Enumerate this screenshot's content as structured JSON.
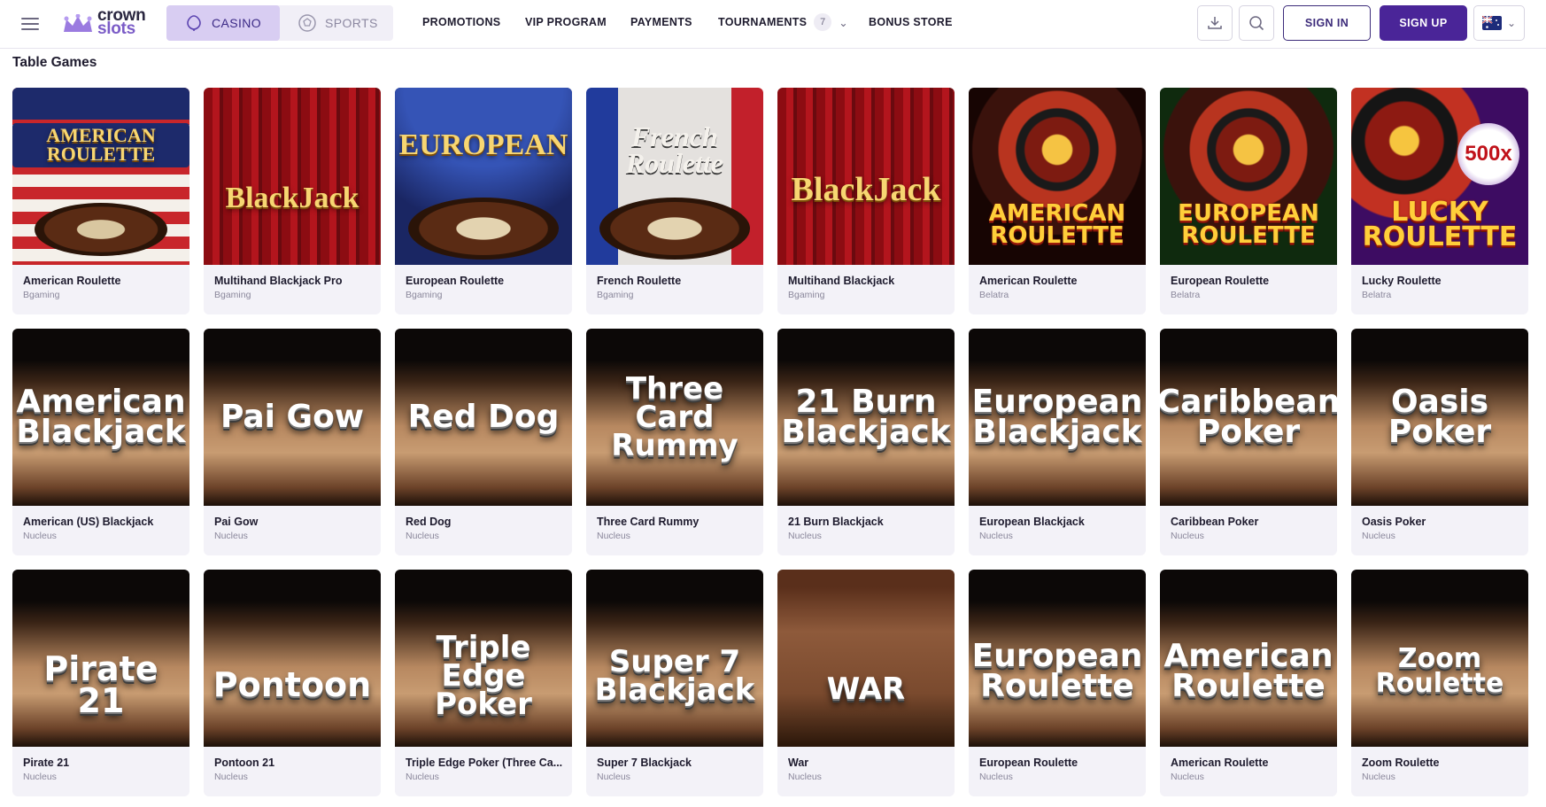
{
  "header": {
    "logo_line1": "crown",
    "logo_line2": "slots",
    "tabs": [
      {
        "label": "CASINO",
        "active": true
      },
      {
        "label": "SPORTS",
        "active": false
      }
    ],
    "nav": [
      "PROMOTIONS",
      "VIP PROGRAM",
      "PAYMENTS",
      "TOURNAMENTS",
      "BONUS STORE"
    ],
    "tournaments_count": "7",
    "sign_in": "SIGN IN",
    "sign_up": "SIGN UP",
    "icons": [
      "menu-icon",
      "download-icon",
      "search-icon",
      "flag-au-icon",
      "chevron-down-icon"
    ]
  },
  "section": {
    "title": "Table Games"
  },
  "colors": {
    "accent": "#4a2598",
    "tab_active_bg": "#d8cdf2",
    "card_bg": "#f3f2f8"
  },
  "games": [
    {
      "name": "American Roulette",
      "provider": "Bgaming",
      "art": "AMERICAN ROULETTE"
    },
    {
      "name": "Multihand Blackjack Pro",
      "provider": "Bgaming",
      "art": "BlackJack"
    },
    {
      "name": "European Roulette",
      "provider": "Bgaming",
      "art": "EUROPEAN"
    },
    {
      "name": "French Roulette",
      "provider": "Bgaming",
      "art": "French Roulette"
    },
    {
      "name": "Multihand Blackjack",
      "provider": "Bgaming",
      "art": "BlackJack"
    },
    {
      "name": "American Roulette",
      "provider": "Belatra",
      "art": "AMERICAN ROULETTE"
    },
    {
      "name": "European Roulette",
      "provider": "Belatra",
      "art": "EUROPEAN ROULETTE"
    },
    {
      "name": "Lucky Roulette",
      "provider": "Belatra",
      "art": "LUCKY ROULETTE"
    },
    {
      "name": "American (US) Blackjack",
      "provider": "Nucleus",
      "art": "American Blackjack"
    },
    {
      "name": "Pai Gow",
      "provider": "Nucleus",
      "art": "Pai Gow"
    },
    {
      "name": "Red Dog",
      "provider": "Nucleus",
      "art": "Red Dog"
    },
    {
      "name": "Three Card Rummy",
      "provider": "Nucleus",
      "art": "Three Card Rummy"
    },
    {
      "name": "21 Burn Blackjack",
      "provider": "Nucleus",
      "art": "21 Burn Blackjack"
    },
    {
      "name": "European Blackjack",
      "provider": "Nucleus",
      "art": "European Blackjack"
    },
    {
      "name": "Caribbean Poker",
      "provider": "Nucleus",
      "art": "Caribbean Poker"
    },
    {
      "name": "Oasis Poker",
      "provider": "Nucleus",
      "art": "Oasis Poker"
    },
    {
      "name": "Pirate 21",
      "provider": "Nucleus",
      "art": "Pirate 21"
    },
    {
      "name": "Pontoon 21",
      "provider": "Nucleus",
      "art": "Pontoon"
    },
    {
      "name": "Triple Edge Poker (Three Ca...",
      "provider": "Nucleus",
      "art": "Triple Edge Poker"
    },
    {
      "name": "Super 7 Blackjack",
      "provider": "Nucleus",
      "art": "Super 7 Blackjack"
    },
    {
      "name": "War",
      "provider": "Nucleus",
      "art": "WAR"
    },
    {
      "name": "European Roulette",
      "provider": "Nucleus",
      "art": "European Roulette"
    },
    {
      "name": "American Roulette",
      "provider": "Nucleus",
      "art": "American Roulette"
    },
    {
      "name": "Zoom Roulette",
      "provider": "Nucleus",
      "art": "Zoom Roulette"
    }
  ]
}
